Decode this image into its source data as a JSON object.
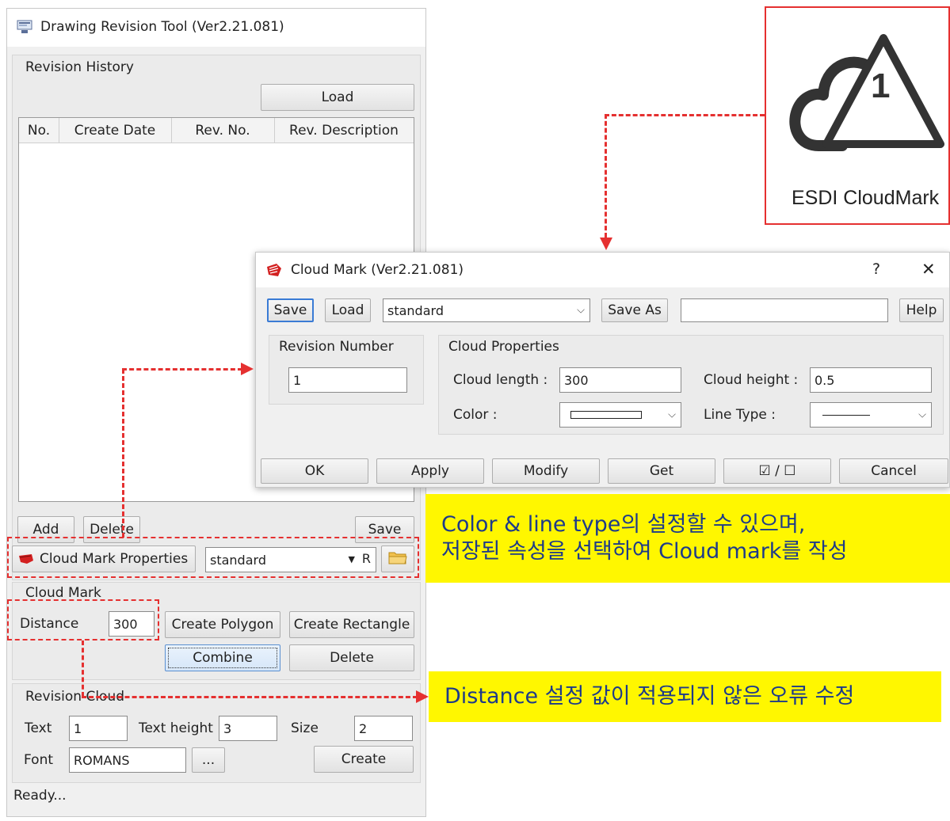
{
  "main_window": {
    "title": "Drawing Revision Tool (Ver2.21.081)",
    "revision_history": {
      "group_label": "Revision History",
      "load_label": "Load",
      "columns": [
        "No.",
        "Create Date",
        "Rev. No.",
        "Rev. Description"
      ],
      "add_label": "Add",
      "delete_label": "Delete",
      "save_label": "Save"
    },
    "cloud_mark_properties": {
      "button_label": "Cloud Mark Properties",
      "selected": "standard",
      "r_label": "R"
    },
    "cloud_mark": {
      "group_label": "Cloud Mark",
      "distance_label": "Distance",
      "distance_value": "300",
      "create_polygon_label": "Create Polygon",
      "create_rectangle_label": "Create Rectangle",
      "combine_label": "Combine",
      "delete_label": "Delete"
    },
    "revision_cloud": {
      "group_label": "Revision Cloud",
      "text_label": "Text",
      "text_value": "1",
      "text_height_label": "Text height",
      "text_height_value": "3",
      "size_label": "Size",
      "size_value": "2",
      "font_label": "Font",
      "font_value": "ROMANS",
      "browse_label": "...",
      "create_label": "Create"
    },
    "status": "Ready..."
  },
  "dialog": {
    "title": "Cloud Mark (Ver2.21.081)",
    "help_glyph": "?",
    "close_glyph": "✕",
    "toolbar": {
      "save_label": "Save",
      "load_label": "Load",
      "preset_value": "standard",
      "save_as_label": "Save As",
      "save_as_value": "",
      "help_label": "Help"
    },
    "revision_number": {
      "group_label": "Revision Number",
      "value": "1"
    },
    "cloud_properties": {
      "group_label": "Cloud Properties",
      "cloud_length_label": "Cloud length :",
      "cloud_length_value": "300",
      "cloud_height_label": "Cloud height :",
      "cloud_height_value": "0.5",
      "color_label": "Color :",
      "line_type_label": "Line Type :"
    },
    "buttons": {
      "ok": "OK",
      "apply": "Apply",
      "modify": "Modify",
      "get": "Get",
      "toggle": "☑ / ☐",
      "cancel": "Cancel"
    }
  },
  "logo": {
    "number": "1",
    "caption": "ESDI CloudMark"
  },
  "notes": {
    "note1_line1": "Color & line type의 설정할 수 있으며,",
    "note1_line2": "저장된 속성을 선택하여 Cloud mark를 작성",
    "note2": "Distance 설정 값이 적용되지 않은 오류 수정"
  },
  "colors": {
    "annotation_red": "#e53030",
    "note_yellow": "#fff700",
    "note_text": "#1d3a8a"
  }
}
